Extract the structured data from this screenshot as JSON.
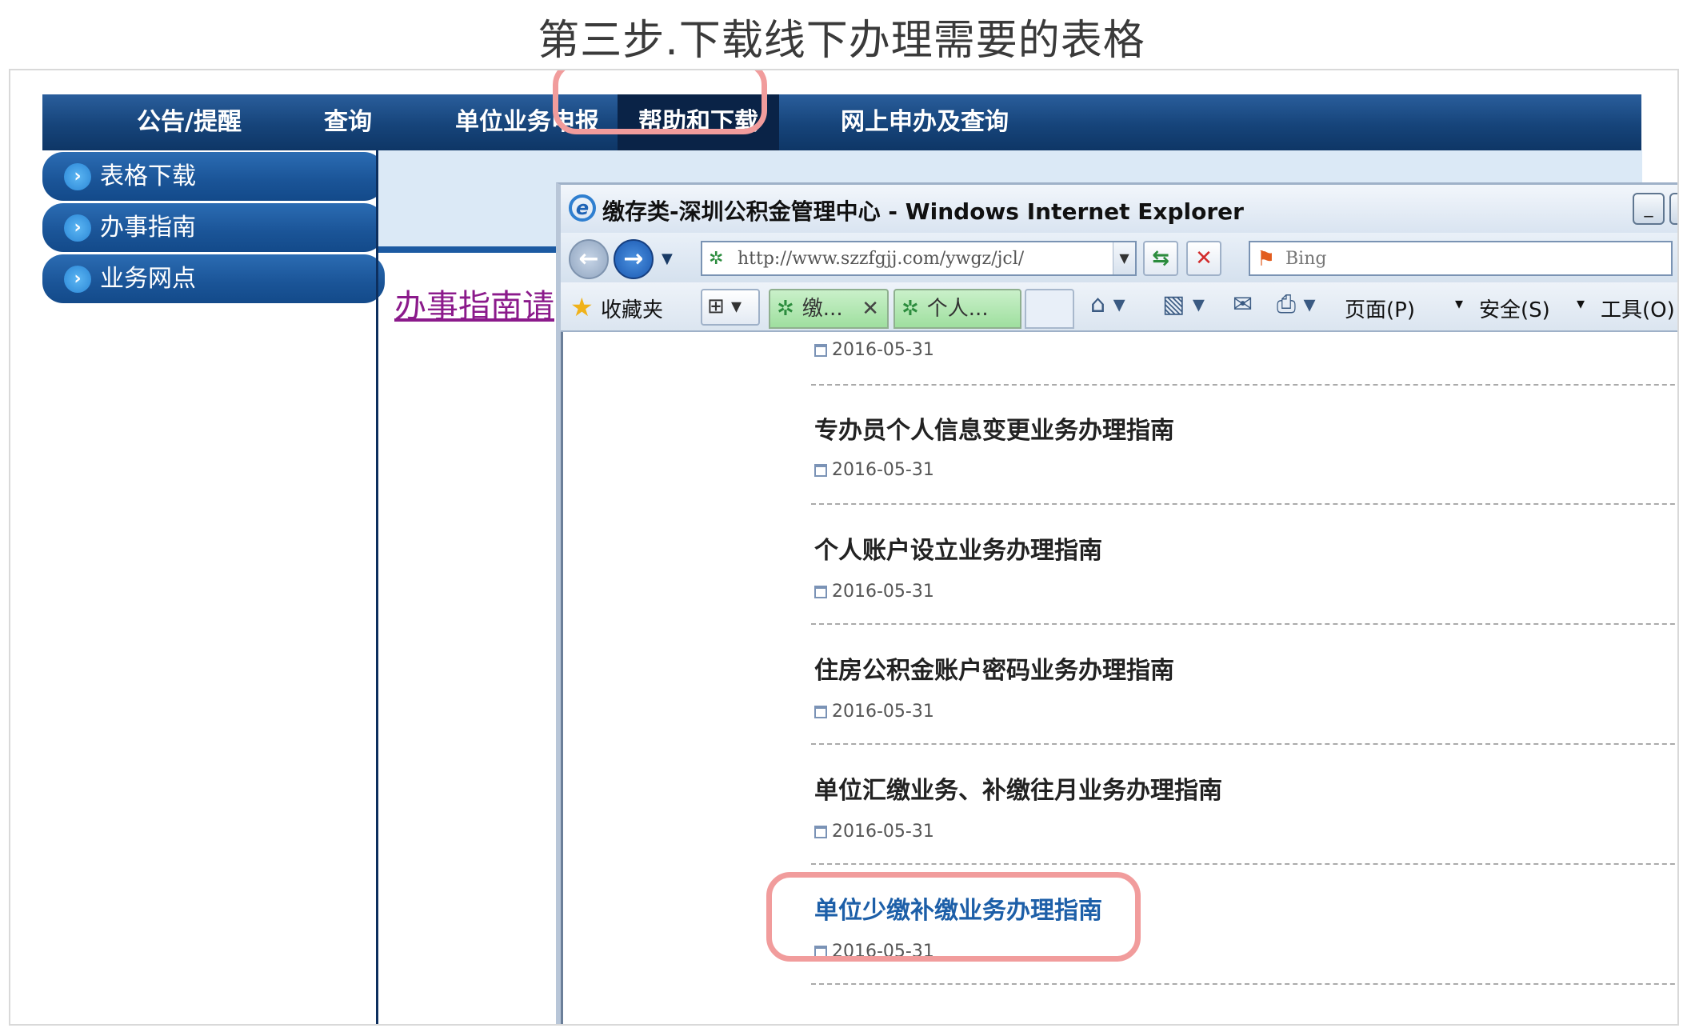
{
  "step_title": "第三步.下载线下办理需要的表格",
  "topnav": {
    "items": [
      "公告/提醒",
      "查询",
      "单位业务申报",
      "帮助和下载",
      "网上申办及查询"
    ],
    "active": "帮助和下载"
  },
  "leftmenu": {
    "items": [
      "表格下载",
      "办事指南",
      "业务网点"
    ]
  },
  "guide_link": "办事指南请",
  "ie": {
    "window_title": "缴存类-深圳公积金管理中心 - Windows Internet Explorer",
    "minimize": "_",
    "maximize": "□",
    "url": "http://www.szzfgjj.com/ywgz/jcl/",
    "search_placeholder": "Bing",
    "favorites": "收藏夹",
    "tabs": [
      "缴...",
      "个人..."
    ],
    "commands": {
      "page": "页面(P)",
      "safety": "安全(S)",
      "tools": "工具(O)"
    }
  },
  "entries": [
    {
      "title": "",
      "date": "2016-05-31"
    },
    {
      "title": "专办员个人信息变更业务办理指南",
      "date": "2016-05-31"
    },
    {
      "title": "个人账户设立业务办理指南",
      "date": "2016-05-31"
    },
    {
      "title": "住房公积金账户密码业务办理指南",
      "date": "2016-05-31"
    },
    {
      "title": "单位汇缴业务、补缴往月业务办理指南",
      "date": "2016-05-31"
    },
    {
      "title": "单位少缴补缴业务办理指南",
      "date": "2016-05-31"
    }
  ],
  "colors": {
    "highlight": "#f19c9c",
    "nav_blue": "#16447a",
    "link_blue": "#1d5fa8",
    "guide_purple": "#8b1a8b"
  }
}
